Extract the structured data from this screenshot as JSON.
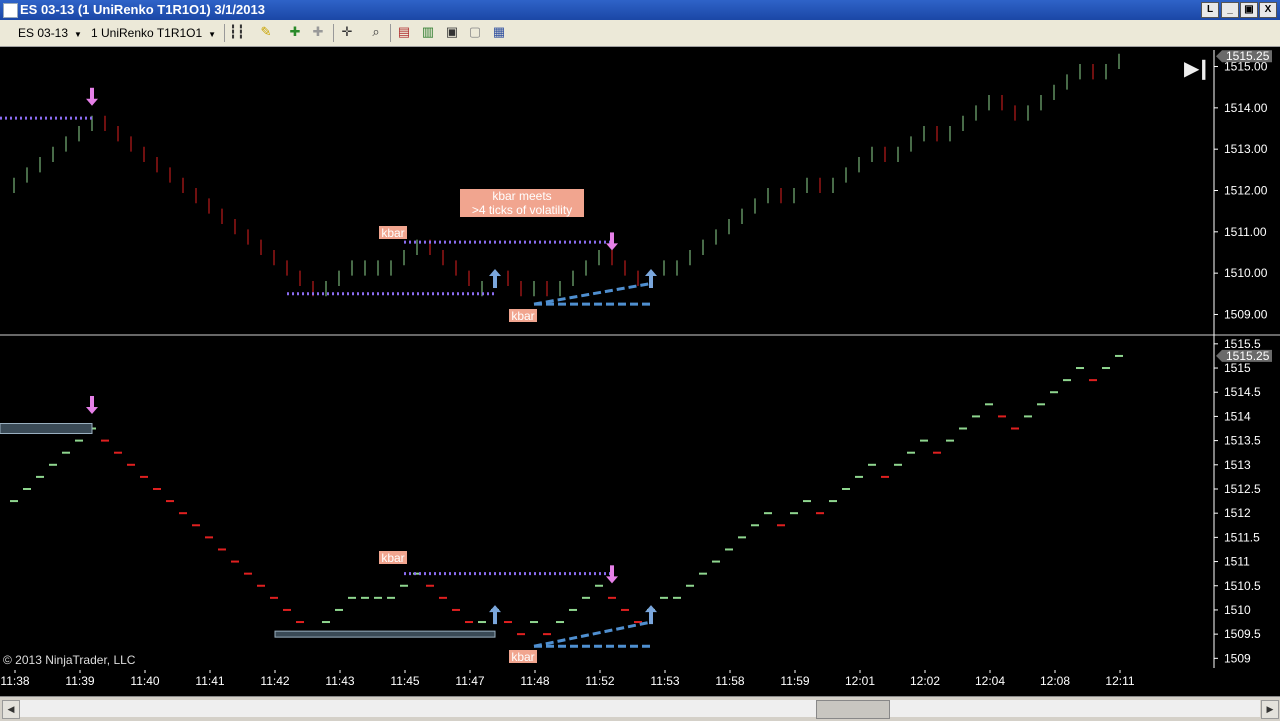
{
  "window": {
    "title": "ES 03-13 (1 UniRenko T1R1O1)  3/1/2013",
    "buttons": [
      "L",
      "_",
      "▣",
      "X"
    ]
  },
  "toolbar": {
    "instrument": "ES 03-13",
    "period": "1 UniRenko T1R1O1"
  },
  "colors": {
    "up_bar": "#8fd68f",
    "down_bar": "#e02020",
    "dotted_line": "#8a6cf0",
    "dashed_line": "#4f8fd0",
    "label_bg": "#f1a58f",
    "arrow_down": "#e680e8",
    "arrow_up": "#7aa6dc",
    "box_fill": "#3a4a56"
  },
  "upper_panel": {
    "price_labels": [
      "1515.00",
      "1514.00",
      "1513.00",
      "1512.00",
      "1511.00",
      "1510.00",
      "1509.00"
    ],
    "last_price": "1515.25",
    "annotation_line1": "kbar meets",
    "annotation_line2": ">4 ticks of volatility",
    "kbar_label_1": "kbar",
    "kbar_label_2": "kbar"
  },
  "lower_panel": {
    "price_labels": [
      "1515.5",
      "1515",
      "1514.5",
      "1514",
      "1513.5",
      "1513",
      "1512.5",
      "1512",
      "1511.5",
      "1511",
      "1510.5",
      "1510",
      "1509.5",
      "1509"
    ],
    "last_price": "1515.25",
    "kbar_label_1": "kbar",
    "kbar_label_2": "kbar"
  },
  "x_axis": {
    "labels": [
      "11:38",
      "11:39",
      "11:40",
      "11:41",
      "11:42",
      "11:43",
      "11:45",
      "11:47",
      "11:48",
      "11:52",
      "11:53",
      "11:58",
      "11:59",
      "12:01",
      "12:02",
      "12:04",
      "12:08",
      "12:11"
    ]
  },
  "chart_data": {
    "type": "bar",
    "series": [
      {
        "values": [
          1512.25,
          1512.5,
          1512.75,
          1513.0,
          1513.25,
          1513.5,
          1513.75,
          1513.5,
          1513.25,
          1513.0,
          1512.75,
          1512.5,
          1512.25,
          1512.0,
          1511.75,
          1511.5,
          1511.25,
          1511.0,
          1510.75,
          1510.5,
          1510.25,
          1510.0,
          1509.75,
          1509.5,
          1509.75,
          1510.0,
          1510.25,
          1510.25,
          1510.25,
          1510.25,
          1510.5,
          1510.75,
          1510.5,
          1510.25,
          1510.0,
          1509.75,
          1509.75,
          1510.0,
          1509.75,
          1509.5,
          1509.75,
          1509.5,
          1509.75,
          1510.0,
          1510.25,
          1510.5,
          1510.25,
          1510.0,
          1509.75,
          1510.0,
          1510.25,
          1510.25,
          1510.5,
          1510.75,
          1511.0,
          1511.25,
          1511.5,
          1511.75,
          1512.0,
          1511.75,
          1512.0,
          1512.25,
          1512.0,
          1512.25,
          1512.5,
          1512.75,
          1513.0,
          1512.75,
          1513.0,
          1513.25,
          1513.5,
          1513.25,
          1513.5,
          1513.75,
          1514.0,
          1514.25,
          1514.0,
          1513.75,
          1514.0,
          1514.25,
          1514.5,
          1514.75,
          1515.0,
          1514.75,
          1515.0,
          1515.25
        ],
        "directions": [
          1,
          1,
          1,
          1,
          1,
          1,
          1,
          -1,
          -1,
          -1,
          -1,
          -1,
          -1,
          -1,
          -1,
          -1,
          -1,
          -1,
          -1,
          -1,
          -1,
          -1,
          -1,
          -1,
          1,
          1,
          1,
          1,
          1,
          1,
          1,
          1,
          -1,
          -1,
          -1,
          -1,
          1,
          1,
          -1,
          -1,
          1,
          -1,
          1,
          1,
          1,
          1,
          -1,
          -1,
          -1,
          1,
          1,
          1,
          1,
          1,
          1,
          1,
          1,
          1,
          1,
          -1,
          1,
          1,
          -1,
          1,
          1,
          1,
          1,
          -1,
          1,
          1,
          1,
          -1,
          1,
          1,
          1,
          1,
          -1,
          -1,
          1,
          1,
          1,
          1,
          1,
          -1,
          1,
          1
        ],
        "down_arrows": [
          6,
          46
        ],
        "up_arrows": [
          37,
          49
        ],
        "dotted_levels": [
          {
            "from": 0,
            "to": 6,
            "value": 1513.75
          },
          {
            "from": 21,
            "to": 37,
            "value": 1509.5
          },
          {
            "from": 30,
            "to": 46,
            "value": 1510.75
          }
        ],
        "dashed_levels": [
          {
            "from": 40,
            "to": 49,
            "start": 1509.25,
            "end": 1509.75
          },
          {
            "from": 40,
            "to": 49,
            "start": 1509.25,
            "end": 1509.25
          }
        ]
      }
    ],
    "upper_ylim": [
      1508.6,
      1515.4
    ],
    "lower_ylim": [
      1508.8,
      1515.6
    ]
  }
}
